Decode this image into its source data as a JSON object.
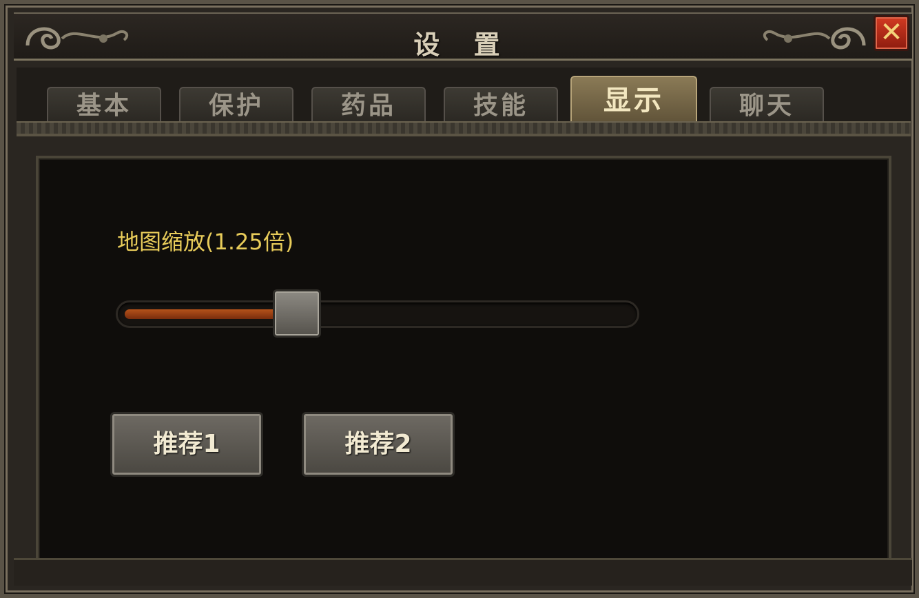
{
  "window": {
    "title": "设 置",
    "close_label": "✕"
  },
  "tabs": [
    {
      "label": "基本",
      "active": false
    },
    {
      "label": "保护",
      "active": false
    },
    {
      "label": "药品",
      "active": false
    },
    {
      "label": "技能",
      "active": false
    },
    {
      "label": "显示",
      "active": true
    },
    {
      "label": "聊天",
      "active": false
    }
  ],
  "display_settings": {
    "zoom_label": "地图缩放(1.25倍)",
    "zoom_slider_fraction": 0.33,
    "preset_buttons": [
      {
        "label": "推荐1"
      },
      {
        "label": "推荐2"
      }
    ]
  },
  "colors": {
    "label_gold": "#e8cc5a",
    "slider_fill": "#b5521a",
    "close_red": "#d23a22"
  }
}
